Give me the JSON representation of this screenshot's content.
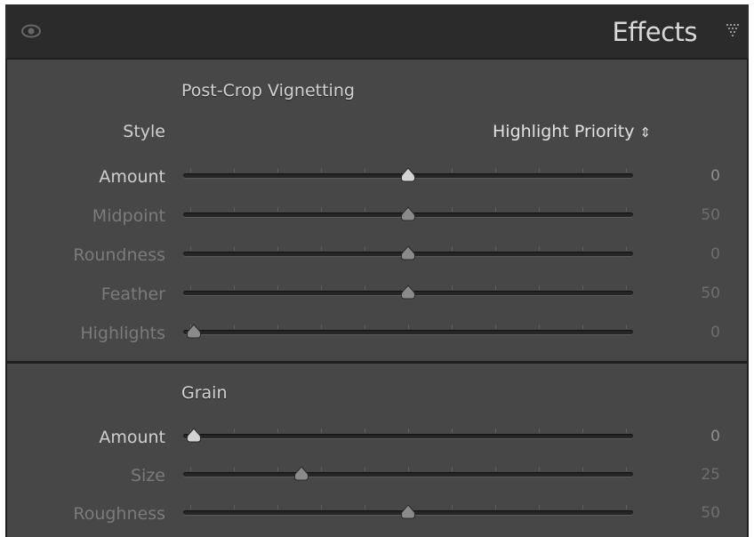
{
  "header": {
    "title": "Effects",
    "visibility_icon": "eye-icon",
    "menu_icon": "panel-menu-triangle-icon"
  },
  "vignetting": {
    "title": "Post-Crop Vignetting",
    "style": {
      "label": "Style",
      "value": "Highlight Priority",
      "arrows": "⇕"
    },
    "sliders": [
      {
        "key": "amount",
        "label": "Amount",
        "value": "0",
        "position": 0.5,
        "active": true
      },
      {
        "key": "midpoint",
        "label": "Midpoint",
        "value": "50",
        "position": 0.5,
        "active": false
      },
      {
        "key": "roundness",
        "label": "Roundness",
        "value": "0",
        "position": 0.5,
        "active": false
      },
      {
        "key": "feather",
        "label": "Feather",
        "value": "50",
        "position": 0.5,
        "active": false
      },
      {
        "key": "highlights",
        "label": "Highlights",
        "value": "0",
        "position": 0.0,
        "active": false
      }
    ]
  },
  "grain": {
    "title": "Grain",
    "sliders": [
      {
        "key": "amount",
        "label": "Amount",
        "value": "0",
        "position": 0.0,
        "active": true
      },
      {
        "key": "size",
        "label": "Size",
        "value": "25",
        "position": 0.25,
        "active": false
      },
      {
        "key": "roughness",
        "label": "Roughness",
        "value": "50",
        "position": 0.5,
        "active": false
      }
    ]
  },
  "colors": {
    "panel_background": "#474747",
    "header_background": "#2b2b2b",
    "active_label": "#cfcfcf",
    "inactive_label": "#7b7b7b",
    "active_value": "#8f8f8f",
    "inactive_value": "#6e6e6e"
  }
}
